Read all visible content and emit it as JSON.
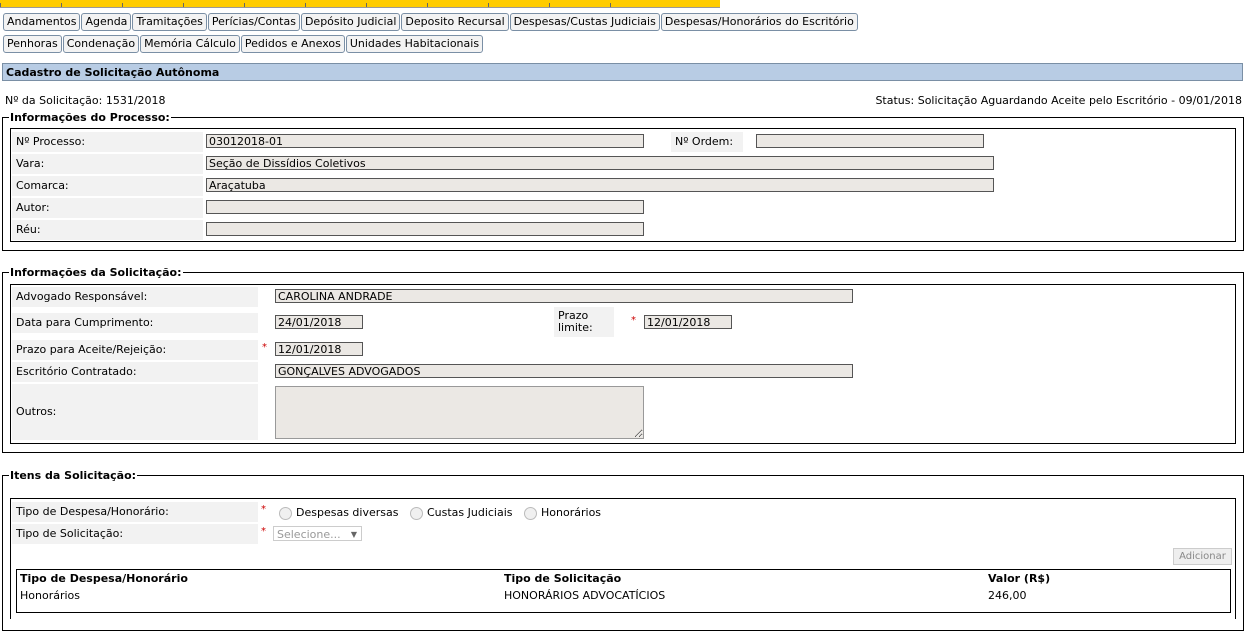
{
  "subtabs_row1": [
    "Andamentos",
    "Agenda",
    "Tramitações",
    "Perícias/Contas",
    "Depósito Judicial",
    "Deposito Recursal",
    "Despesas/Custas Judiciais",
    "Despesas/Honorários do Escritório"
  ],
  "subtabs_row2": [
    "Penhoras",
    "Condenação",
    "Memória Cálculo",
    "Pedidos e Anexos",
    "Unidades Habitacionais"
  ],
  "page_title": "Cadastro de Solicitação Autônoma",
  "solicitacao_numero": "Nº da Solicitação: 1531/2018",
  "status": "Status: Solicitação Aguardando Aceite pelo Escritório - 09/01/2018",
  "processo": {
    "legend": "Informações do Processo:",
    "numero_label": "Nº Processo:",
    "numero_value": "03012018-01",
    "ordem_label": "Nº Ordem:",
    "ordem_value": "",
    "vara_label": "Vara:",
    "vara_value": "Seção de Dissídios Coletivos",
    "comarca_label": "Comarca:",
    "comarca_value": "Araçatuba",
    "autor_label": "Autor:",
    "autor_value": "",
    "reu_label": "Réu:",
    "reu_value": ""
  },
  "solicitacao": {
    "legend": "Informações da Solicitação:",
    "advogado_label": "Advogado Responsável:",
    "advogado_value": "CAROLINA ANDRADE",
    "data_label": "Data para Cumprimento:",
    "data_value": "24/01/2018",
    "prazo_limite_label": "Prazo limite:",
    "prazo_limite_value": "12/01/2018",
    "prazo_aceite_label": "Prazo para Aceite/Rejeição:",
    "prazo_aceite_value": "12/01/2018",
    "escritorio_label": "Escritório Contratado:",
    "escritorio_value": "GONÇALVES ADVOGADOS",
    "outros_label": "Outros:",
    "outros_value": "",
    "required_mark": "*"
  },
  "itens": {
    "legend": "Itens da Solicitação:",
    "tipo_despesa_label": "Tipo de Despesa/Honorário:",
    "radio_options": [
      "Despesas diversas",
      "Custas Judiciais",
      "Honorários"
    ],
    "tipo_solicitacao_label": "Tipo de Solicitação:",
    "select_placeholder": "Selecione...",
    "select_arrow": "▼",
    "adicionar_label": "Adicionar",
    "table_headers": [
      "Tipo de Despesa/Honorário",
      "Tipo de Solicitação",
      "Valor (R$)"
    ],
    "rows": [
      [
        "Honorários",
        "HONORÁRIOS ADVOCATÍCIOS",
        "246,00"
      ]
    ]
  }
}
